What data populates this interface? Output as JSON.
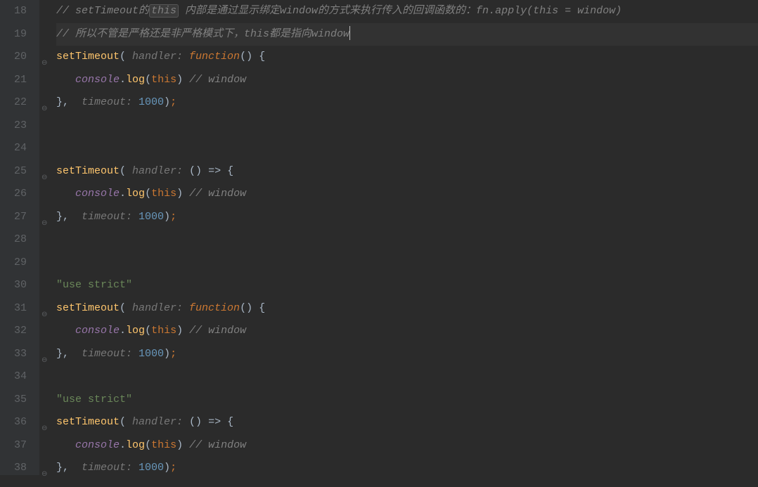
{
  "startLine": 18,
  "activeLine": 19,
  "lines": [
    {
      "num": 18,
      "fold": "",
      "tokens": [
        {
          "cls": "comment",
          "text": "// setTimeout的"
        },
        {
          "cls": "comment highlight-box",
          "text": "this"
        },
        {
          "cls": "comment",
          "text": " 内部是通过显示绑定window的方式来执行传入的回调函数的：fn.apply(this = window)"
        }
      ]
    },
    {
      "num": 19,
      "fold": "",
      "active": true,
      "tokens": [
        {
          "cls": "comment",
          "text": "// 所以不管是严格还是非严格模式下，this都是指向window"
        },
        {
          "cls": "cursor",
          "text": ""
        }
      ]
    },
    {
      "num": 20,
      "fold": "⊖",
      "tokens": [
        {
          "cls": "builtin",
          "text": "setTimeout"
        },
        {
          "cls": "punc",
          "text": "( "
        },
        {
          "cls": "param-hint",
          "text": "handler: "
        },
        {
          "cls": "fn",
          "text": "function"
        },
        {
          "cls": "punc",
          "text": "() {"
        }
      ]
    },
    {
      "num": 21,
      "fold": "",
      "tokens": [
        {
          "cls": "ident",
          "text": "   "
        },
        {
          "cls": "obj",
          "text": "console"
        },
        {
          "cls": "punc",
          "text": "."
        },
        {
          "cls": "method",
          "text": "log"
        },
        {
          "cls": "punc",
          "text": "("
        },
        {
          "cls": "this-kw",
          "text": "this"
        },
        {
          "cls": "punc",
          "text": ") "
        },
        {
          "cls": "comment",
          "text": "// window"
        }
      ]
    },
    {
      "num": 22,
      "fold": "⊖",
      "tokens": [
        {
          "cls": "punc",
          "text": "},  "
        },
        {
          "cls": "param-hint",
          "text": "timeout: "
        },
        {
          "cls": "number",
          "text": "1000"
        },
        {
          "cls": "punc",
          "text": ")"
        },
        {
          "cls": "semicol",
          "text": ";"
        }
      ]
    },
    {
      "num": 23,
      "fold": "",
      "tokens": []
    },
    {
      "num": 24,
      "fold": "",
      "tokens": []
    },
    {
      "num": 25,
      "fold": "⊖",
      "tokens": [
        {
          "cls": "builtin",
          "text": "setTimeout"
        },
        {
          "cls": "punc",
          "text": "( "
        },
        {
          "cls": "param-hint",
          "text": "handler: "
        },
        {
          "cls": "punc",
          "text": "() "
        },
        {
          "cls": "arrow",
          "text": "=>"
        },
        {
          "cls": "punc",
          "text": " {"
        }
      ]
    },
    {
      "num": 26,
      "fold": "",
      "tokens": [
        {
          "cls": "ident",
          "text": "   "
        },
        {
          "cls": "obj",
          "text": "console"
        },
        {
          "cls": "punc",
          "text": "."
        },
        {
          "cls": "method",
          "text": "log"
        },
        {
          "cls": "punc",
          "text": "("
        },
        {
          "cls": "this-kw",
          "text": "this"
        },
        {
          "cls": "punc",
          "text": ") "
        },
        {
          "cls": "comment",
          "text": "// window"
        }
      ]
    },
    {
      "num": 27,
      "fold": "⊖",
      "tokens": [
        {
          "cls": "punc",
          "text": "},  "
        },
        {
          "cls": "param-hint",
          "text": "timeout: "
        },
        {
          "cls": "number",
          "text": "1000"
        },
        {
          "cls": "punc",
          "text": ")"
        },
        {
          "cls": "semicol",
          "text": ";"
        }
      ]
    },
    {
      "num": 28,
      "fold": "",
      "tokens": []
    },
    {
      "num": 29,
      "fold": "",
      "tokens": []
    },
    {
      "num": 30,
      "fold": "",
      "tokens": [
        {
          "cls": "string",
          "text": "\"use strict\""
        }
      ]
    },
    {
      "num": 31,
      "fold": "⊖",
      "tokens": [
        {
          "cls": "builtin",
          "text": "setTimeout"
        },
        {
          "cls": "punc",
          "text": "( "
        },
        {
          "cls": "param-hint",
          "text": "handler: "
        },
        {
          "cls": "fn",
          "text": "function"
        },
        {
          "cls": "punc",
          "text": "() {"
        }
      ]
    },
    {
      "num": 32,
      "fold": "",
      "tokens": [
        {
          "cls": "ident",
          "text": "   "
        },
        {
          "cls": "obj",
          "text": "console"
        },
        {
          "cls": "punc",
          "text": "."
        },
        {
          "cls": "method",
          "text": "log"
        },
        {
          "cls": "punc",
          "text": "("
        },
        {
          "cls": "this-kw",
          "text": "this"
        },
        {
          "cls": "punc",
          "text": ") "
        },
        {
          "cls": "comment",
          "text": "// window"
        }
      ]
    },
    {
      "num": 33,
      "fold": "⊖",
      "tokens": [
        {
          "cls": "punc",
          "text": "},  "
        },
        {
          "cls": "param-hint",
          "text": "timeout: "
        },
        {
          "cls": "number",
          "text": "1000"
        },
        {
          "cls": "punc",
          "text": ")"
        },
        {
          "cls": "semicol",
          "text": ";"
        }
      ]
    },
    {
      "num": 34,
      "fold": "",
      "tokens": []
    },
    {
      "num": 35,
      "fold": "",
      "tokens": [
        {
          "cls": "string",
          "text": "\"use strict\""
        }
      ]
    },
    {
      "num": 36,
      "fold": "⊖",
      "tokens": [
        {
          "cls": "builtin",
          "text": "setTimeout"
        },
        {
          "cls": "punc",
          "text": "( "
        },
        {
          "cls": "param-hint",
          "text": "handler: "
        },
        {
          "cls": "punc",
          "text": "() "
        },
        {
          "cls": "arrow",
          "text": "=>"
        },
        {
          "cls": "punc",
          "text": " {"
        }
      ]
    },
    {
      "num": 37,
      "fold": "",
      "tokens": [
        {
          "cls": "ident",
          "text": "   "
        },
        {
          "cls": "obj",
          "text": "console"
        },
        {
          "cls": "punc",
          "text": "."
        },
        {
          "cls": "method",
          "text": "log"
        },
        {
          "cls": "punc",
          "text": "("
        },
        {
          "cls": "this-kw",
          "text": "this"
        },
        {
          "cls": "punc",
          "text": ") "
        },
        {
          "cls": "comment",
          "text": "// window"
        }
      ]
    },
    {
      "num": 38,
      "fold": "⊖",
      "tokens": [
        {
          "cls": "punc",
          "text": "},  "
        },
        {
          "cls": "param-hint",
          "text": "timeout: "
        },
        {
          "cls": "number",
          "text": "1000"
        },
        {
          "cls": "punc",
          "text": ")"
        },
        {
          "cls": "semicol",
          "text": ";"
        }
      ]
    }
  ]
}
